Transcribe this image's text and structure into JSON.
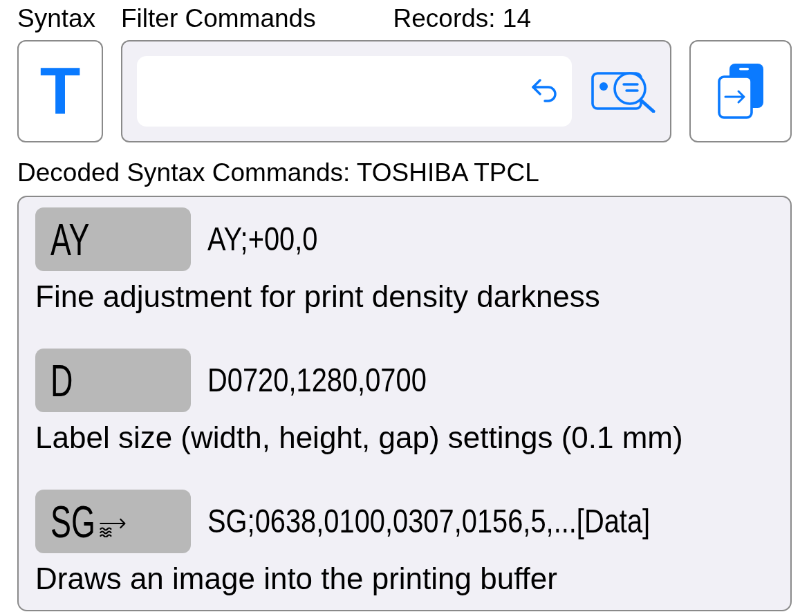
{
  "labels": {
    "syntax": "Syntax",
    "filter": "Filter Commands",
    "records": "Records: 14"
  },
  "syntax_button": {
    "label": "T"
  },
  "section_title": "Decoded Syntax Commands: TOSHIBA TPCL",
  "commands": [
    {
      "code": "AY",
      "data_icon": false,
      "command": "AY;+00,0",
      "description": "Fine adjustment for print density darkness"
    },
    {
      "code": "D",
      "data_icon": false,
      "command": "D0720,1280,0700",
      "description": "Label size (width, height, gap) settings (0.1 mm)"
    },
    {
      "code": "SG",
      "data_icon": true,
      "command": "SG;0638,0100,0307,0156,5,...[Data]",
      "description": "Draws an image into the printing buffer"
    }
  ]
}
